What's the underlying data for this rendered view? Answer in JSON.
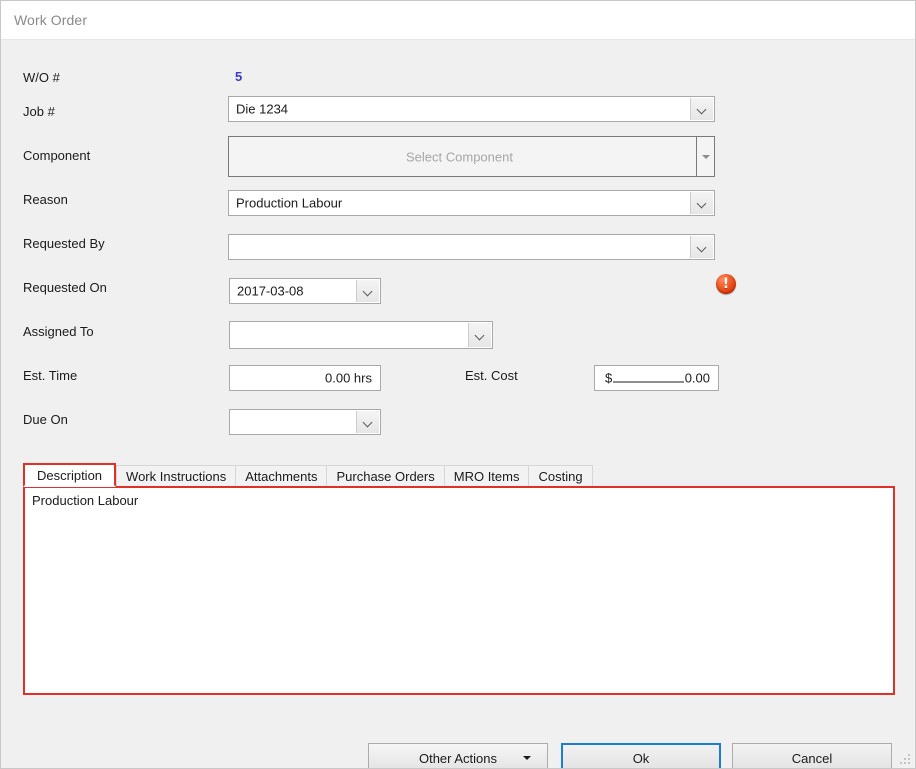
{
  "window": {
    "title": "Work Order"
  },
  "form": {
    "wo_number": {
      "label": "W/O #",
      "value": "5",
      "color": "#3a3ad0"
    },
    "job_number": {
      "label": "Job #",
      "value": "Die 1234"
    },
    "component": {
      "label": "Component",
      "placeholder": "Select Component"
    },
    "reason": {
      "label": "Reason",
      "value": "Production Labour"
    },
    "requested_by": {
      "label": "Requested By",
      "value": "",
      "error": true
    },
    "requested_on": {
      "label": "Requested On",
      "value": "2017-03-08"
    },
    "assigned_to": {
      "label": "Assigned To",
      "value": ""
    },
    "est_time": {
      "label": "Est. Time",
      "value": "0.00 hrs"
    },
    "est_cost": {
      "label": "Est. Cost",
      "symbol": "$",
      "value": "0.00"
    },
    "due_on": {
      "label": "Due On",
      "value": ""
    }
  },
  "tabs": {
    "items": [
      {
        "label": "Description",
        "active": true
      },
      {
        "label": "Work Instructions",
        "active": false
      },
      {
        "label": "Attachments",
        "active": false
      },
      {
        "label": "Purchase Orders",
        "active": false
      },
      {
        "label": "MRO Items",
        "active": false
      },
      {
        "label": "Costing",
        "active": false
      }
    ],
    "panel_text": "Production Labour"
  },
  "footer": {
    "other_actions": "Other Actions",
    "ok": "Ok",
    "cancel": "Cancel"
  },
  "colors": {
    "accent_red": "#e03128",
    "focus_blue": "#1a7fd4",
    "value_blue": "#3a3ad0",
    "error_orange": "#f05a23"
  }
}
